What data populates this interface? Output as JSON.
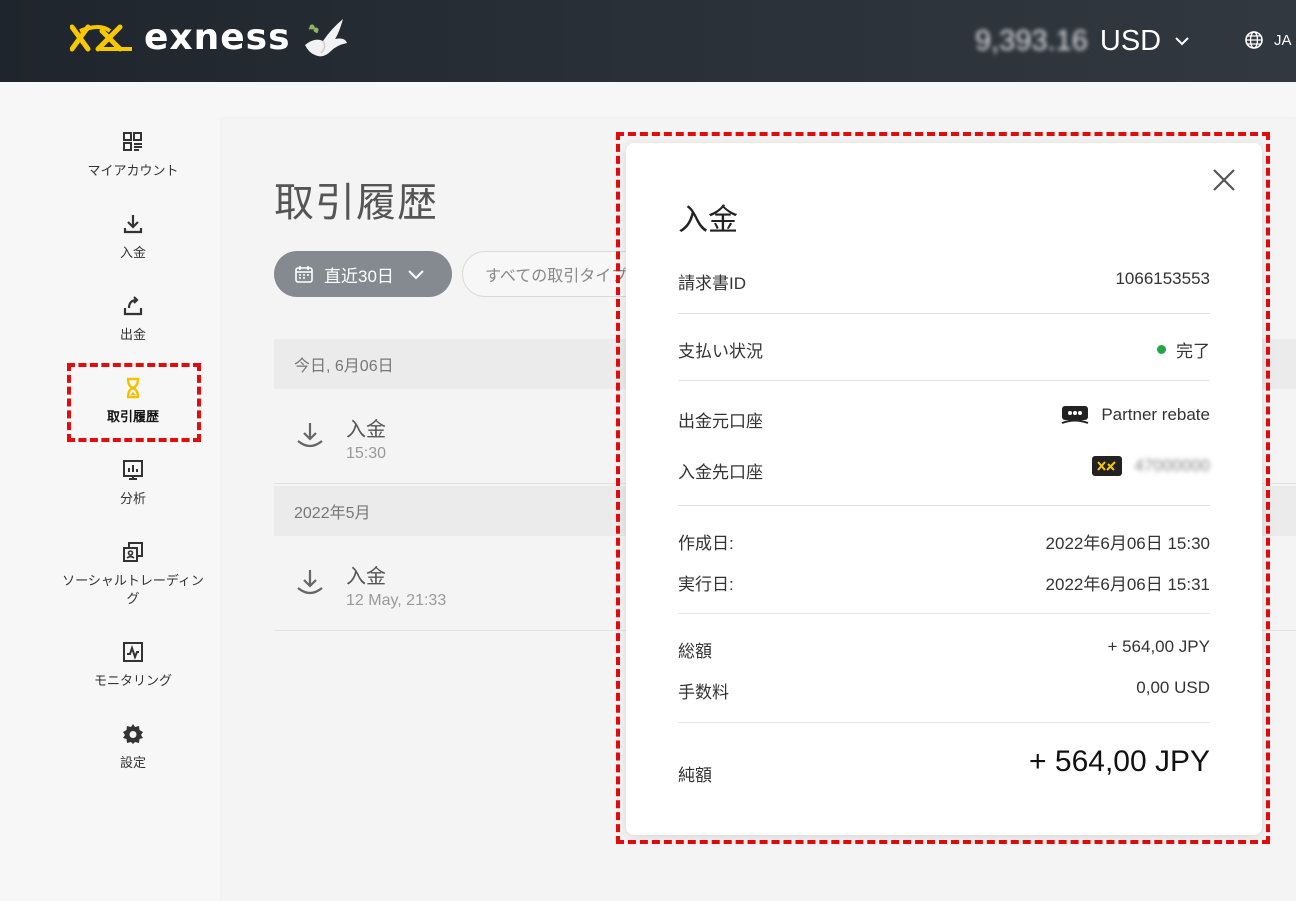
{
  "header": {
    "brand": "exness",
    "balance_amount": "9,393.16",
    "balance_currency": "USD",
    "language": "JA",
    "colors": {
      "brand_yellow": "#f7c800",
      "header_bg": "#262c33"
    }
  },
  "sidebar": {
    "items": [
      {
        "label": "マイアカウント",
        "icon": "grid-icon"
      },
      {
        "label": "入金",
        "icon": "download-icon"
      },
      {
        "label": "出金",
        "icon": "upload-icon"
      },
      {
        "label": "取引履歴",
        "icon": "hourglass-icon",
        "active": true
      },
      {
        "label": "分析",
        "icon": "chart-icon"
      },
      {
        "label": "ソーシャルトレーディング",
        "icon": "copy-icon"
      },
      {
        "label": "モニタリング",
        "icon": "monitoring-icon"
      },
      {
        "label": "設定",
        "icon": "gear-icon"
      }
    ]
  },
  "main": {
    "title": "取引履歴",
    "date_filter": "直近30日",
    "type_filter": "すべての取引タイプ",
    "groups": [
      {
        "header": "今日, 6月06日",
        "rows": [
          {
            "title": "入金",
            "time": "15:30"
          }
        ]
      },
      {
        "header": "2022年5月",
        "rows": [
          {
            "title": "入金",
            "time": "12 May, 21:33"
          }
        ]
      }
    ]
  },
  "modal": {
    "title": "入金",
    "invoice_label": "請求書ID",
    "invoice_value": "1066153553",
    "status_label": "支払い状況",
    "status_value": "完了",
    "from_label": "出金元口座",
    "from_value": "Partner rebate",
    "to_label": "入金先口座",
    "to_value": "47000000",
    "created_label": "作成日:",
    "created_value": "2022年6月06日 15:30",
    "executed_label": "実行日:",
    "executed_value": "2022年6月06日 15:31",
    "total_label": "総額",
    "total_value": "+ 564,00 JPY",
    "fee_label": "手数料",
    "fee_value": "0,00 USD",
    "net_label": "純額",
    "net_value": "+ 564,00 JPY",
    "status_color": "#22a748"
  }
}
